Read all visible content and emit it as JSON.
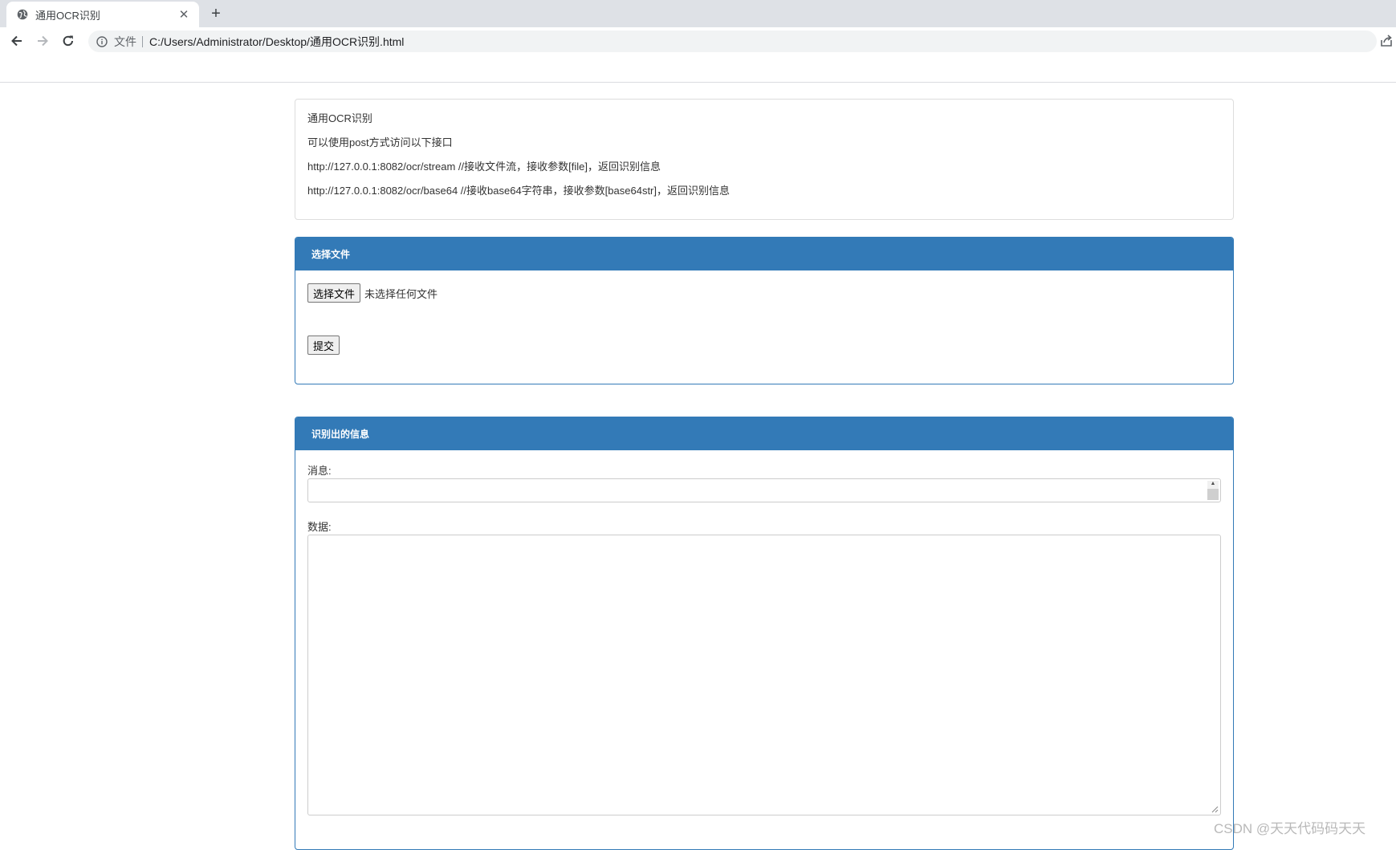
{
  "browser": {
    "tab_title": "通用OCR识别",
    "new_tab_label": "+",
    "close_label": "✕",
    "scheme_label": "文件",
    "url": "C:/Users/Administrator/Desktop/通用OCR识别.html"
  },
  "info": {
    "lines": [
      "通用OCR识别",
      "可以使用post方式访问以下接口",
      "http://127.0.0.1:8082/ocr/stream //接收文件流，接收参数[file]，返回识别信息",
      "http://127.0.0.1:8082/ocr/base64 //接收base64字符串，接收参数[base64str]，返回识别信息"
    ]
  },
  "file_panel": {
    "heading": "选择文件",
    "choose_button": "选择文件",
    "no_file_text": "未选择任何文件",
    "submit_button": "提交"
  },
  "result_panel": {
    "heading": "识别出的信息",
    "message_label": "消息:",
    "message_value": "",
    "data_label": "数据:",
    "data_value": ""
  },
  "watermark": "CSDN @天天代码码天天",
  "colors": {
    "panel_primary": "#337ab7",
    "tabstrip": "#dee1e6",
    "omnibox": "#f1f3f4"
  }
}
